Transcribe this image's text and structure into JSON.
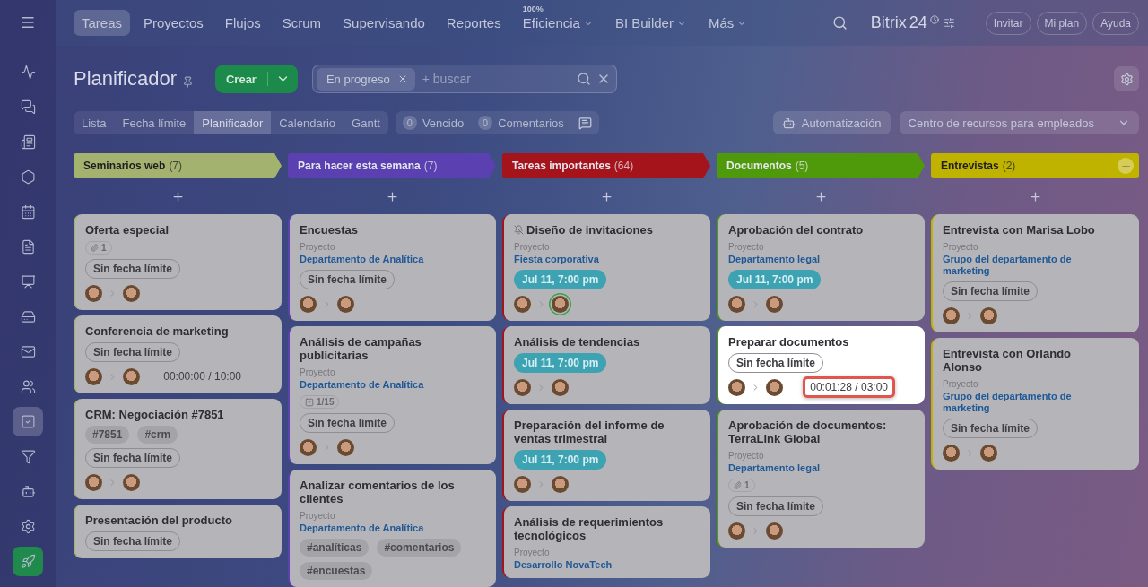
{
  "topnav": {
    "items": [
      {
        "label": "Tareas",
        "selected": true,
        "kind": "tab"
      },
      {
        "label": "Proyectos",
        "selected": false,
        "kind": "tab"
      },
      {
        "label": "Flujos",
        "selected": false,
        "kind": "tab"
      },
      {
        "label": "Scrum",
        "selected": false,
        "kind": "tab"
      },
      {
        "label": "Supervisando",
        "selected": false,
        "kind": "tab"
      },
      {
        "label": "Reportes",
        "selected": false,
        "kind": "tab"
      },
      {
        "label": "Eficiencia",
        "selected": false,
        "kind": "dropdown",
        "badge": "100%"
      },
      {
        "label": "BI Builder",
        "selected": false,
        "kind": "dropdown"
      },
      {
        "label": "Más",
        "selected": false,
        "kind": "dropdown"
      }
    ],
    "brand": "Bitrix",
    "brand_number": "24",
    "buttons": [
      "Invitar",
      "Mi plan",
      "Ayuda"
    ]
  },
  "sidebar": [
    {
      "kind": "pulse",
      "selected": false
    },
    {
      "kind": "chat",
      "selected": false
    },
    {
      "kind": "feed",
      "selected": false
    },
    {
      "kind": "hexagon",
      "selected": false
    },
    {
      "kind": "calendar",
      "selected": false
    },
    {
      "kind": "document",
      "selected": false
    },
    {
      "kind": "presentation",
      "selected": false
    },
    {
      "kind": "drive",
      "selected": false
    },
    {
      "kind": "mail",
      "selected": false
    },
    {
      "kind": "contacts",
      "selected": false
    },
    {
      "kind": "tasks",
      "selected": true
    },
    {
      "kind": "funnel",
      "selected": false
    },
    {
      "kind": "robot",
      "selected": false
    },
    {
      "kind": "settings",
      "selected": false
    },
    {
      "kind": "rocket",
      "selected": false
    }
  ],
  "header": {
    "title": "Planificador",
    "create_button": "Crear",
    "filter_chip": "En progreso",
    "search": {
      "placeholder": "+ buscar"
    }
  },
  "views": [
    {
      "label": "Lista",
      "selected": false
    },
    {
      "label": "Fecha límite",
      "selected": false
    },
    {
      "label": "Planificador",
      "selected": true
    },
    {
      "label": "Calendario",
      "selected": false
    },
    {
      "label": "Gantt",
      "selected": false
    }
  ],
  "counters": [
    {
      "count": "0",
      "label": "Vencido"
    },
    {
      "count": "0",
      "label": "Comentarios"
    }
  ],
  "automation_button": "Automatización",
  "resource_dropdown": "Centro de recursos para empleados",
  "columns": [
    {
      "title": "Seminarios web",
      "count": "(7)",
      "color": "#a3b36f",
      "add_button": false,
      "cards": [
        {
          "title": "Oferta especial",
          "highlighted": false,
          "attachments": "1",
          "deadline": {
            "kind": "none",
            "text": "Sin fecha límite"
          },
          "people": [
            {
              "ring": false
            },
            {
              "ring": false
            }
          ]
        },
        {
          "title": "Conferencia de marketing",
          "highlighted": false,
          "deadline": {
            "kind": "none",
            "text": "Sin fecha límite"
          },
          "people": [
            {
              "ring": false
            },
            {
              "ring": false
            }
          ],
          "timer": {
            "text": "00:00:00 / 10:00",
            "highlighted": false
          }
        },
        {
          "title": "CRM: Negociación #7851",
          "highlighted": false,
          "tags": [
            "#7851",
            "#crm"
          ],
          "deadline": {
            "kind": "none",
            "text": "Sin fecha límite"
          },
          "people": [
            {
              "ring": false
            },
            {
              "ring": false
            }
          ]
        },
        {
          "title": "Presentación del producto",
          "highlighted": false,
          "deadline": {
            "kind": "none",
            "text": "Sin fecha límite"
          }
        }
      ]
    },
    {
      "title": "Para hacer esta semana",
      "count": "(7)",
      "color": "#5a40b0",
      "add_button": false,
      "cards": [
        {
          "title": "Encuestas",
          "highlighted": false,
          "project_label": "Proyecto",
          "project": "Departamento de Analítica",
          "deadline": {
            "kind": "none",
            "text": "Sin fecha límite"
          },
          "people": [
            {
              "ring": false
            },
            {
              "ring": false
            }
          ]
        },
        {
          "title": "Análisis de campañas publicitarias",
          "highlighted": false,
          "project_label": "Proyecto",
          "project": "Departamento de Analítica",
          "checklist": "1/15",
          "deadline": {
            "kind": "none",
            "text": "Sin fecha límite"
          },
          "people": [
            {
              "ring": false
            },
            {
              "ring": false
            }
          ]
        },
        {
          "title": "Analizar comentarios de los clientes",
          "highlighted": false,
          "project_label": "Proyecto",
          "project": "Departamento de Analítica",
          "tags": [
            "#analíticas",
            "#comentarios",
            "#encuestas"
          ]
        }
      ]
    },
    {
      "title": "Tareas importantes",
      "count": "(64)",
      "color": "#a5131b",
      "add_button": false,
      "cards": [
        {
          "title": "Diseño de invitaciones",
          "highlighted": false,
          "muted": true,
          "project_label": "Proyecto",
          "project": "Fiesta corporativa",
          "deadline": {
            "kind": "date",
            "text": "Jul 11, 7:00 pm"
          },
          "people": [
            {
              "ring": false
            },
            {
              "ring": true
            }
          ]
        },
        {
          "title": "Análisis de tendencias",
          "highlighted": false,
          "deadline": {
            "kind": "date",
            "text": "Jul 11, 7:00 pm"
          },
          "people": [
            {
              "ring": false
            },
            {
              "ring": false
            }
          ]
        },
        {
          "title": "Preparación del informe de ventas trimestral",
          "highlighted": false,
          "deadline": {
            "kind": "date",
            "text": "Jul 11, 7:00 pm"
          },
          "people": [
            {
              "ring": false
            },
            {
              "ring": false
            }
          ]
        },
        {
          "title": "Análisis de requerimientos tecnológicos",
          "highlighted": false,
          "project_label": "Proyecto",
          "project": "Desarrollo NovaTech"
        }
      ]
    },
    {
      "title": "Documentos",
      "count": "(5)",
      "color": "#4f9a0b",
      "add_button": false,
      "cards": [
        {
          "title": "Aprobación del contrato",
          "highlighted": false,
          "project_label": "Proyecto",
          "project": "Departamento legal",
          "deadline": {
            "kind": "date",
            "text": "Jul 11, 7:00 pm"
          },
          "people": [
            {
              "ring": false
            },
            {
              "ring": false
            }
          ]
        },
        {
          "title": "Preparar documentos",
          "highlighted": true,
          "deadline": {
            "kind": "none",
            "text": "Sin fecha límite"
          },
          "people": [
            {
              "ring": false
            },
            {
              "ring": false
            }
          ],
          "timer": {
            "text": "00:01:28 / 03:00",
            "highlighted": true
          }
        },
        {
          "title": "Aprobación de documentos: TerraLink Global",
          "highlighted": false,
          "project_label": "Proyecto",
          "project": "Departamento legal",
          "attachments": "1",
          "deadline": {
            "kind": "none",
            "text": "Sin fecha límite"
          },
          "people": [
            {
              "ring": false
            },
            {
              "ring": false
            }
          ]
        }
      ]
    },
    {
      "title": "Entrevistas",
      "count": "(2)",
      "color": "#c0b300",
      "add_button": true,
      "cards": [
        {
          "title": "Entrevista con Marisa Lobo",
          "highlighted": false,
          "project_label": "Proyecto",
          "project": "Grupo del departamento de marketing",
          "deadline": {
            "kind": "none",
            "text": "Sin fecha límite"
          },
          "people": [
            {
              "ring": false
            },
            {
              "ring": false
            }
          ]
        },
        {
          "title": "Entrevista con Orlando Alonso",
          "highlighted": false,
          "project_label": "Proyecto",
          "project": "Grupo del departamento de marketing",
          "deadline": {
            "kind": "none",
            "text": "Sin fecha límite"
          },
          "people": [
            {
              "ring": false
            },
            {
              "ring": false
            }
          ]
        }
      ]
    }
  ]
}
